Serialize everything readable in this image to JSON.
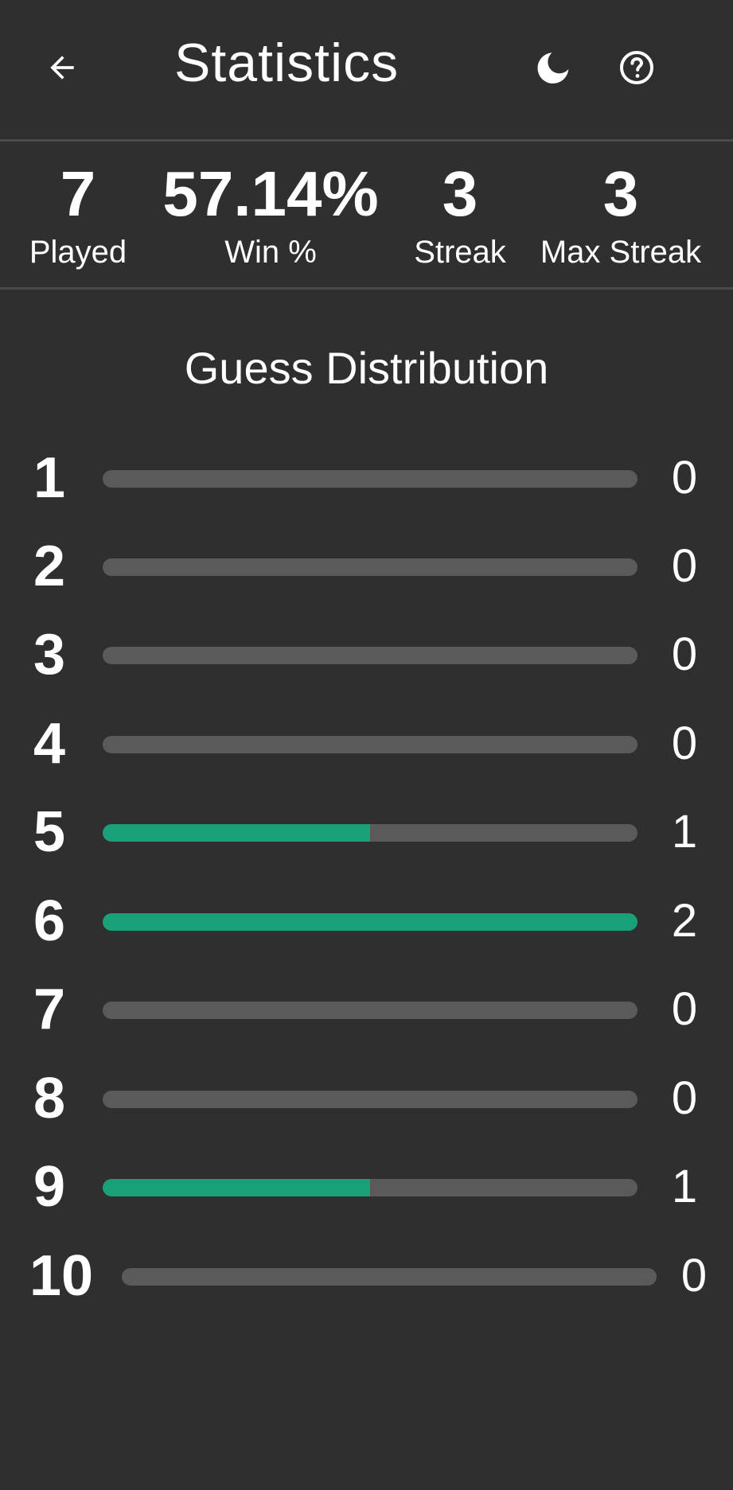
{
  "header": {
    "title": "Statistics",
    "back_icon": "arrow-left-icon",
    "theme_icon": "moon-icon",
    "help_icon": "help-circle-icon"
  },
  "stats": {
    "played": {
      "value": "7",
      "label": "Played"
    },
    "win": {
      "value": "57.14%",
      "label": "Win %"
    },
    "streak": {
      "value": "3",
      "label": "Streak"
    },
    "max_streak": {
      "value": "3",
      "label": "Max Streak"
    }
  },
  "distribution": {
    "title": "Guess Distribution",
    "rows": [
      {
        "guess": "1",
        "count": "0",
        "fill": 0
      },
      {
        "guess": "2",
        "count": "0",
        "fill": 0
      },
      {
        "guess": "3",
        "count": "0",
        "fill": 0
      },
      {
        "guess": "4",
        "count": "0",
        "fill": 0
      },
      {
        "guess": "5",
        "count": "1",
        "fill": 0.5
      },
      {
        "guess": "6",
        "count": "2",
        "fill": 1
      },
      {
        "guess": "7",
        "count": "0",
        "fill": 0
      },
      {
        "guess": "8",
        "count": "0",
        "fill": 0
      },
      {
        "guess": "9",
        "count": "1",
        "fill": 0.5
      },
      {
        "guess": "10",
        "count": "0",
        "fill": 0
      }
    ]
  },
  "colors": {
    "background": "#2f2f2f",
    "bar_track": "#5a5a5a",
    "bar_fill": "#1aa079",
    "divider": "#4a4a4a",
    "text": "#ffffff"
  }
}
